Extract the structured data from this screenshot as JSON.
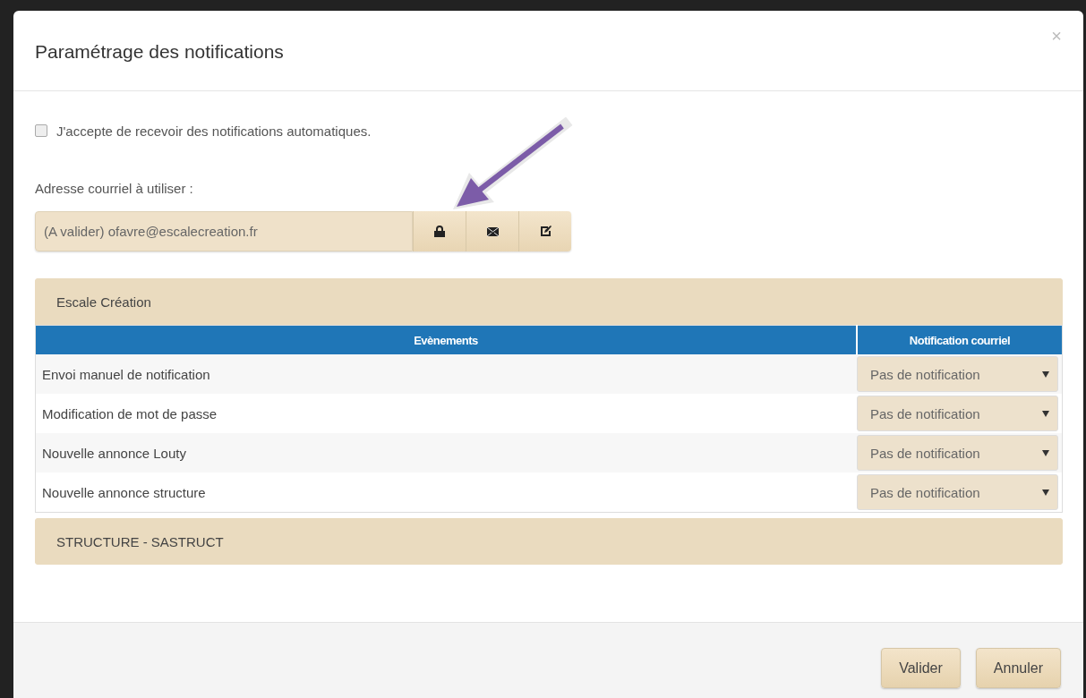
{
  "dialog": {
    "title": "Paramétrage des notifications",
    "close": "×"
  },
  "consent": {
    "label": "J'accepte de recevoir des notifications automatiques.",
    "checked": false
  },
  "email": {
    "label": "Adresse courriel à utiliser :",
    "value": "(A valider) ofavre@escalecreation.fr",
    "actions": [
      {
        "kind": "lock"
      },
      {
        "kind": "mail"
      },
      {
        "kind": "edit"
      }
    ]
  },
  "groups": [
    {
      "title": "Escale Création",
      "expanded": true,
      "columns": [
        "Evènements",
        "Notification courriel"
      ],
      "rows": [
        {
          "event": "Envoi manuel de notification",
          "notification": "Pas de notification"
        },
        {
          "event": "Modification de mot de passe",
          "notification": "Pas de notification"
        },
        {
          "event": "Nouvelle annonce Louty",
          "notification": "Pas de notification"
        },
        {
          "event": "Nouvelle annonce structure",
          "notification": "Pas de notification"
        }
      ]
    },
    {
      "title": "STRUCTURE - SASTRUCT",
      "expanded": false
    }
  ],
  "footer": {
    "buttons": [
      "Valider",
      "Annuler"
    ]
  }
}
